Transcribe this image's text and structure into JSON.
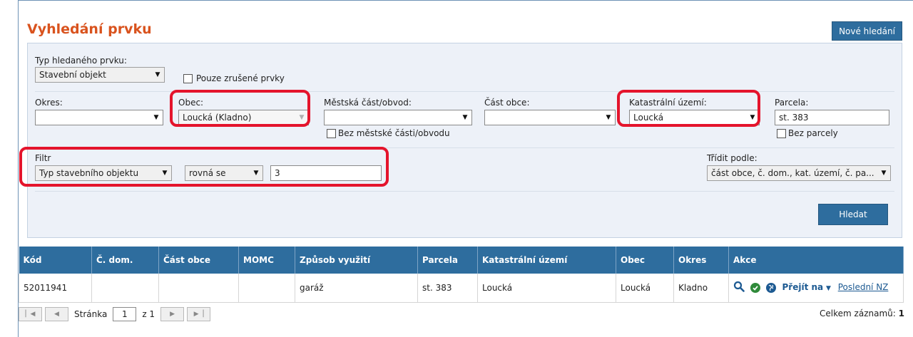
{
  "title": "Vyhledání prvku",
  "new_search_label": "Nové hledání",
  "filters": {
    "element_type_label": "Typ hledaného prvku:",
    "element_type_value": "Stavební objekt",
    "only_cancelled_label": "Pouze zrušené prvky",
    "okres_label": "Okres:",
    "okres_value": "",
    "obec_label": "Obec:",
    "obec_value": "Loucká (Kladno)",
    "mestska_cast_label": "Městská část/obvod:",
    "mestska_cast_value": "",
    "bez_mestske_casti_label": "Bez městské části/obvodu",
    "cast_obce_label": "Část obce:",
    "cast_obce_value": "",
    "katastralni_uzemi_label": "Katastrální území:",
    "katastralni_uzemi_value": "Loucká",
    "parcela_label": "Parcela:",
    "parcela_value": "st. 383",
    "bez_parcely_label": "Bez parcely",
    "filtr_label": "Filtr",
    "filtr_field_value": "Typ stavebního objektu",
    "filtr_operator_value": "rovná se",
    "filtr_value": "3",
    "sort_label": "Třídit podle:",
    "sort_value": "část obce, č. dom., kat. území, č. pa..."
  },
  "search_label": "Hledat",
  "table": {
    "columns": [
      "Kód",
      "Č. dom.",
      "Část obce",
      "MOMC",
      "Způsob využití",
      "Parcela",
      "Katastrální území",
      "Obec",
      "Okres",
      "Akce"
    ],
    "rows": [
      {
        "kod": "52011941",
        "c_dom": "",
        "cast_obce": "",
        "momc": "",
        "zpusob_vyuziti": "garáž",
        "parcela": "st. 383",
        "katastralni_uzemi": "Loucká",
        "obec": "Loucká",
        "okres": "Kladno",
        "goto_label": "Přejít na",
        "last_nz_label": "Poslední NZ"
      }
    ]
  },
  "pager": {
    "page_label": "Stránka",
    "current_page": "1",
    "of_label": "z 1",
    "total_label": "Celkem záznamů:",
    "total_value": "1"
  },
  "colors": {
    "accent": "#2e6d9e",
    "title": "#d9531e",
    "highlight": "#e4142c"
  }
}
